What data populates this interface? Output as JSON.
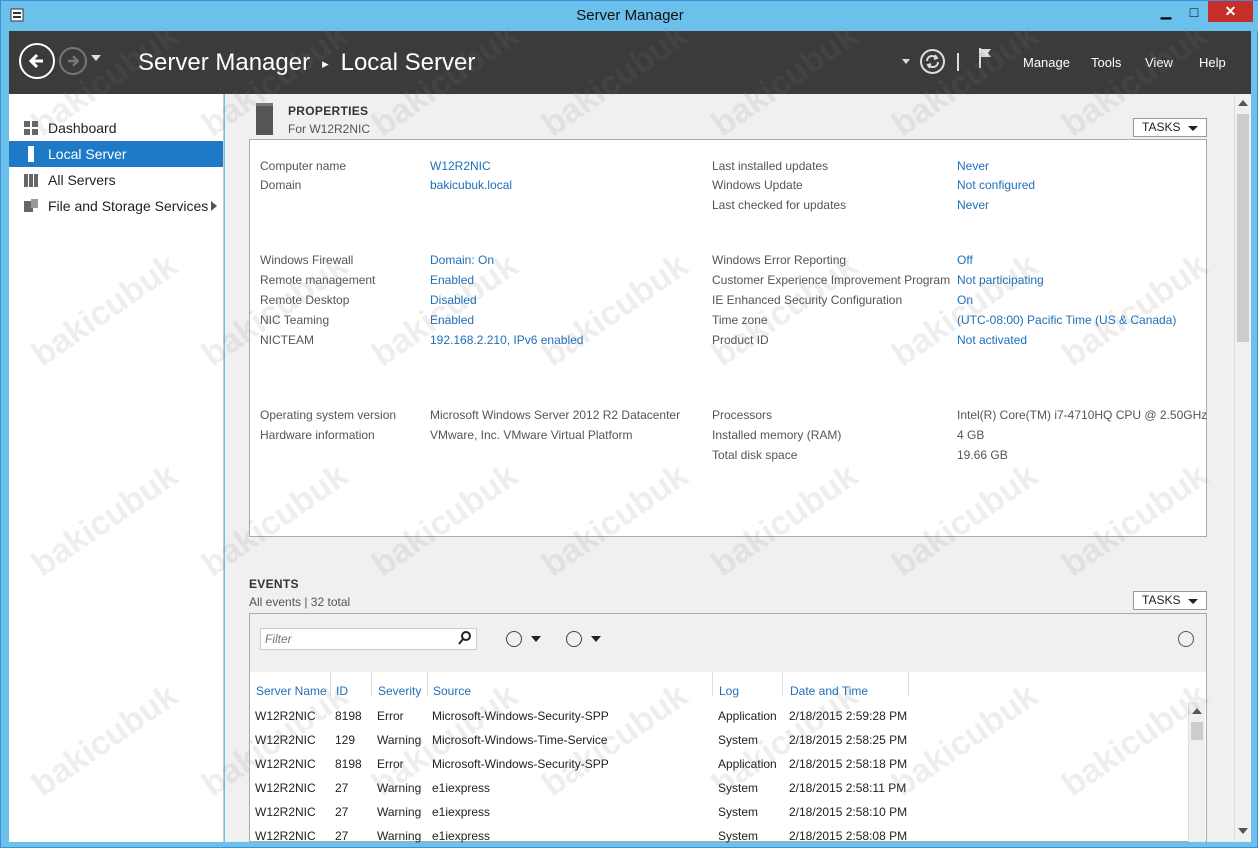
{
  "window": {
    "title": "Server Manager",
    "minimize": "▁",
    "maximize": "□",
    "close": "✕"
  },
  "header": {
    "breadcrumb": [
      "Server Manager",
      "Local Server"
    ],
    "breadcrumb_separator": "▸",
    "menus": [
      "Manage",
      "Tools",
      "View",
      "Help"
    ]
  },
  "sidebar": {
    "items": [
      {
        "label": "Dashboard",
        "icon": "dashboard-icon",
        "selected": false
      },
      {
        "label": "Local Server",
        "icon": "local-server-icon",
        "selected": true
      },
      {
        "label": "All Servers",
        "icon": "all-servers-icon",
        "selected": false
      },
      {
        "label": "File and Storage Services",
        "icon": "storage-icon",
        "selected": false,
        "has_submenu": true
      }
    ]
  },
  "properties": {
    "title": "PROPERTIES",
    "subtitle": "For W12R2NIC",
    "tasks": "TASKS",
    "left": [
      {
        "label": "Computer name",
        "value": "W12R2NIC",
        "link": true
      },
      {
        "label": "Domain",
        "value": "bakicubuk.local",
        "link": true
      },
      {
        "label": "Windows Firewall",
        "value": "Domain: On",
        "link": true
      },
      {
        "label": "Remote management",
        "value": "Enabled",
        "link": true
      },
      {
        "label": "Remote Desktop",
        "value": "Disabled",
        "link": true
      },
      {
        "label": "NIC Teaming",
        "value": "Enabled",
        "link": true
      },
      {
        "label": "NICTEAM",
        "value": "192.168.2.210, IPv6 enabled",
        "link": true
      },
      {
        "label": "Operating system version",
        "value": "Microsoft Windows Server 2012 R2 Datacenter",
        "link": false
      },
      {
        "label": "Hardware information",
        "value": "VMware, Inc. VMware Virtual Platform",
        "link": false
      }
    ],
    "right": [
      {
        "label": "Last installed updates",
        "value": "Never",
        "link": true
      },
      {
        "label": "Windows Update",
        "value": "Not configured",
        "link": true
      },
      {
        "label": "Last checked for updates",
        "value": "Never",
        "link": true
      },
      {
        "label": "Windows Error Reporting",
        "value": "Off",
        "link": true
      },
      {
        "label": "Customer Experience Improvement Program",
        "value": "Not participating",
        "link": true
      },
      {
        "label": "IE Enhanced Security Configuration",
        "value": "On",
        "link": true
      },
      {
        "label": "Time zone",
        "value": "(UTC-08:00) Pacific Time (US & Canada)",
        "link": true
      },
      {
        "label": "Product ID",
        "value": "Not activated",
        "link": true
      },
      {
        "label": "Processors",
        "value": "Intel(R) Core(TM) i7-4710HQ CPU @ 2.50GHz",
        "link": false
      },
      {
        "label": "Installed memory (RAM)",
        "value": "4 GB",
        "link": false
      },
      {
        "label": "Total disk space",
        "value": "19.66 GB",
        "link": false
      }
    ]
  },
  "events": {
    "title": "EVENTS",
    "subtitle": "All events | 32 total",
    "tasks": "TASKS",
    "filter_placeholder": "Filter",
    "columns": [
      "Server Name",
      "ID",
      "Severity",
      "Source",
      "Log",
      "Date and Time"
    ],
    "rows": [
      [
        "W12R2NIC",
        "8198",
        "Error",
        "Microsoft-Windows-Security-SPP",
        "Application",
        "2/18/2015 2:59:28 PM"
      ],
      [
        "W12R2NIC",
        "129",
        "Warning",
        "Microsoft-Windows-Time-Service",
        "System",
        "2/18/2015 2:58:25 PM"
      ],
      [
        "W12R2NIC",
        "8198",
        "Error",
        "Microsoft-Windows-Security-SPP",
        "Application",
        "2/18/2015 2:58:18 PM"
      ],
      [
        "W12R2NIC",
        "27",
        "Warning",
        "e1iexpress",
        "System",
        "2/18/2015 2:58:11 PM"
      ],
      [
        "W12R2NIC",
        "27",
        "Warning",
        "e1iexpress",
        "System",
        "2/18/2015 2:58:10 PM"
      ],
      [
        "W12R2NIC",
        "27",
        "Warning",
        "e1iexpress",
        "System",
        "2/18/2015 2:58:08 PM"
      ]
    ]
  },
  "watermark": "bakicubuk",
  "colors": {
    "accent": "#1e7ac6",
    "link": "#1e6fb8",
    "titlebar": "#6cc0ec",
    "header": "#3b3b3b",
    "close": "#c7302a"
  }
}
